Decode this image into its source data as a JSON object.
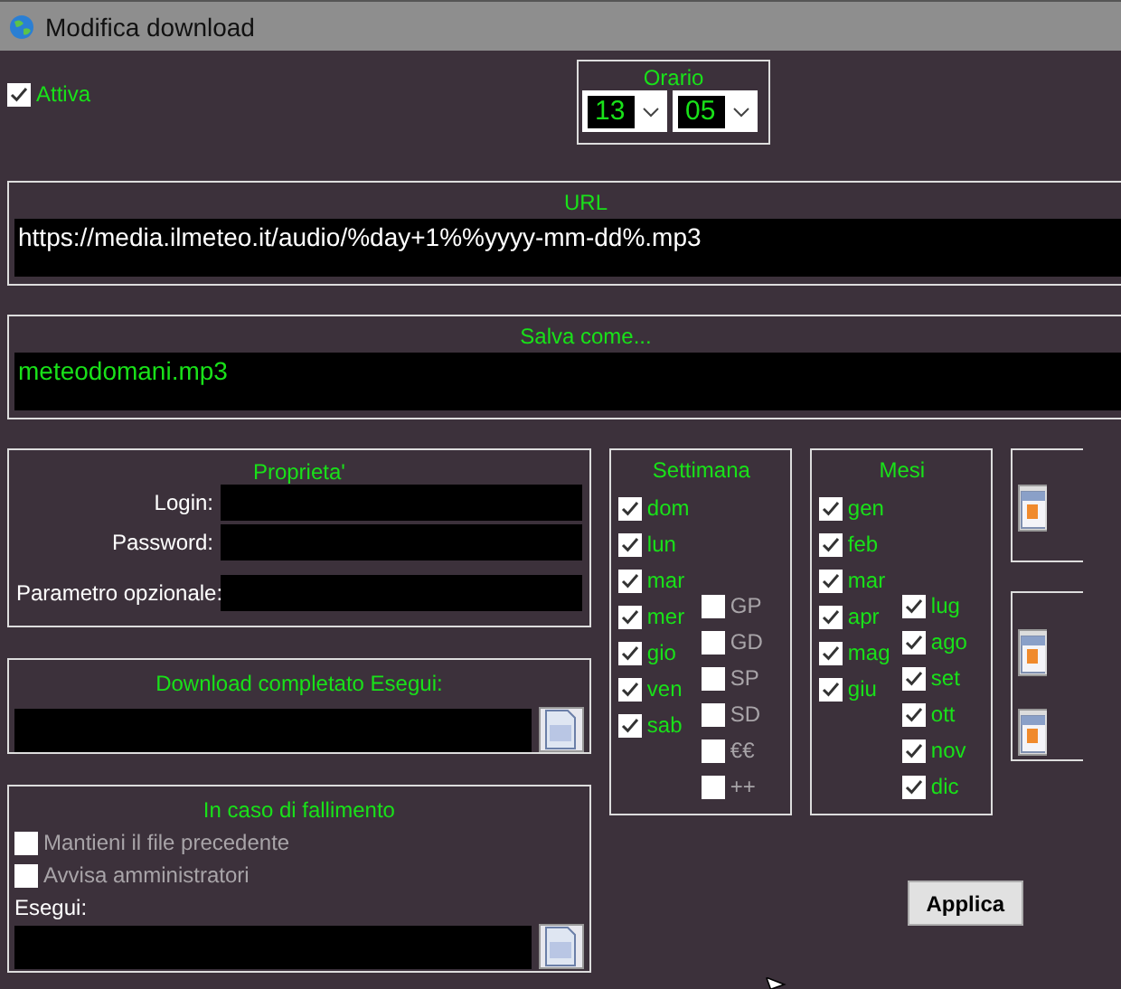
{
  "window": {
    "title": "Modifica download"
  },
  "active": {
    "label": "Attiva",
    "checked": true
  },
  "schedule": {
    "title": "Orario",
    "hour": "13",
    "minute": "05"
  },
  "url": {
    "title": "URL",
    "value": "https://media.ilmeteo.it/audio/%day+1%%yyyy-mm-dd%.mp3"
  },
  "save_as": {
    "title": "Salva come...",
    "value": "meteodomani.mp3"
  },
  "properties": {
    "title": "Proprieta'",
    "fields": [
      {
        "label": "Login:"
      },
      {
        "label": "Password:"
      },
      {
        "label": "Parametro opzionale:"
      }
    ]
  },
  "on_complete": {
    "title": "Download completato Esegui:"
  },
  "on_failure": {
    "title": "In caso di fallimento",
    "run_label": "Esegui:",
    "options": [
      {
        "label": "Mantieni il file precedente",
        "checked": false
      },
      {
        "label": "Avvisa amministratori",
        "checked": false
      }
    ]
  },
  "week": {
    "title": "Settimana",
    "days": [
      {
        "label": "dom",
        "checked": true
      },
      {
        "label": "lun",
        "checked": true
      },
      {
        "label": "mar",
        "checked": true
      },
      {
        "label": "mer",
        "checked": true
      },
      {
        "label": "gio",
        "checked": true
      },
      {
        "label": "ven",
        "checked": true
      },
      {
        "label": "sab",
        "checked": true
      }
    ],
    "extras": [
      {
        "label": "GP",
        "checked": false
      },
      {
        "label": "GD",
        "checked": false
      },
      {
        "label": "SP",
        "checked": false
      },
      {
        "label": "SD",
        "checked": false
      },
      {
        "label": "€€",
        "checked": false
      },
      {
        "label": "++",
        "checked": false
      }
    ]
  },
  "months": {
    "title": "Mesi",
    "first_half": [
      {
        "label": "gen",
        "checked": true
      },
      {
        "label": "feb",
        "checked": true
      },
      {
        "label": "mar",
        "checked": true
      },
      {
        "label": "apr",
        "checked": true
      },
      {
        "label": "mag",
        "checked": true
      },
      {
        "label": "giu",
        "checked": true
      }
    ],
    "second_half": [
      {
        "label": "lug",
        "checked": true
      },
      {
        "label": "ago",
        "checked": true
      },
      {
        "label": "set",
        "checked": true
      },
      {
        "label": "ott",
        "checked": true
      },
      {
        "label": "nov",
        "checked": true
      },
      {
        "label": "dic",
        "checked": true
      }
    ]
  },
  "button": "Applica"
}
